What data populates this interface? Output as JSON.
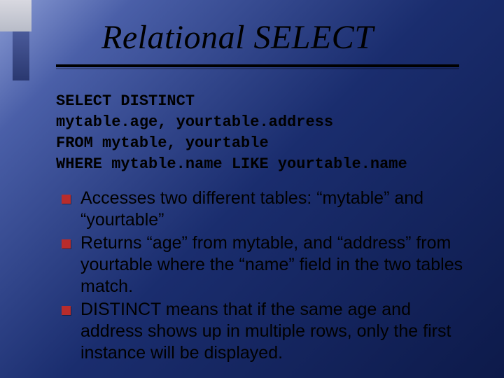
{
  "title": "Relational SELECT",
  "code": {
    "line1": "SELECT DISTINCT",
    "line2": "mytable.age, yourtable.address",
    "line3": "FROM mytable, yourtable",
    "line4": "WHERE mytable.name LIKE yourtable.name"
  },
  "bullets": {
    "item1": "Accesses two different tables: “mytable” and “yourtable”",
    "item2": "Returns “age” from mytable, and “address” from yourtable where the “name” field in the two tables match.",
    "item3": "DISTINCT means that if the same age and address shows up in multiple rows, only the first instance will be displayed."
  }
}
